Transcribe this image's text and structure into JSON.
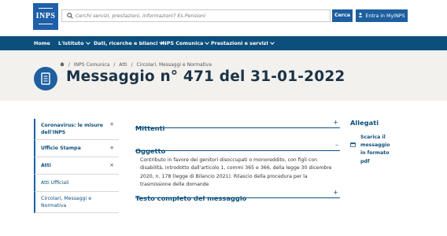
{
  "header": {
    "logo_text": "INPS",
    "search_placeholder": "Cerchi servizi, prestazioni, informazioni? Es.Pensioni",
    "search_button": "Cerca",
    "login_button": "Entra in MyINPS"
  },
  "nav": {
    "items": [
      {
        "label": "Home"
      },
      {
        "label": "L'Istituto"
      },
      {
        "label": "Dati, ricerche e bilanci"
      },
      {
        "label": "INPS Comunica"
      },
      {
        "label": "Prestazioni e servizi"
      }
    ]
  },
  "breadcrumb": [
    "INPS Comunica",
    "Atti",
    "Circolari, Messaggi e Normativa"
  ],
  "page_title": "Messaggio n° 471 del 31-01-2022",
  "sidebar": {
    "items": [
      {
        "label": "Coronavirus: le misure dell'INPS",
        "sign": "+"
      },
      {
        "label": "Ufficio Stampa",
        "sign": "+"
      },
      {
        "label": "Atti",
        "sign": "×"
      }
    ],
    "subitems": [
      {
        "label": "Atti Ufficiali"
      },
      {
        "label": "Circolari, Messaggi e Normativa"
      }
    ]
  },
  "sections": {
    "mittenti": {
      "title": "Mittenti",
      "sign": "+"
    },
    "oggetto": {
      "title": "Oggetto",
      "sign": "–"
    },
    "testo": {
      "title": "Testo completo del messaggio",
      "sign": "+"
    }
  },
  "oggetto_text": "Contributo in favore dei genitori disoccupati o monoreddito, con figli con disabilità, introdotto dall'articolo 1, commi 365 e 366, della legge 30 dicembre 2020, n. 178 (legge di Bilancio 2021). Rilascio della procedura per la trasmissione delle domande",
  "allegati": {
    "title": "Allegati",
    "item": "Scarica il messaggio in formato pdf"
  },
  "colors": {
    "brand_blue": "#1d5fa0",
    "nav_dark": "#0d4f7c",
    "band_bg": "#f2f1ed"
  }
}
